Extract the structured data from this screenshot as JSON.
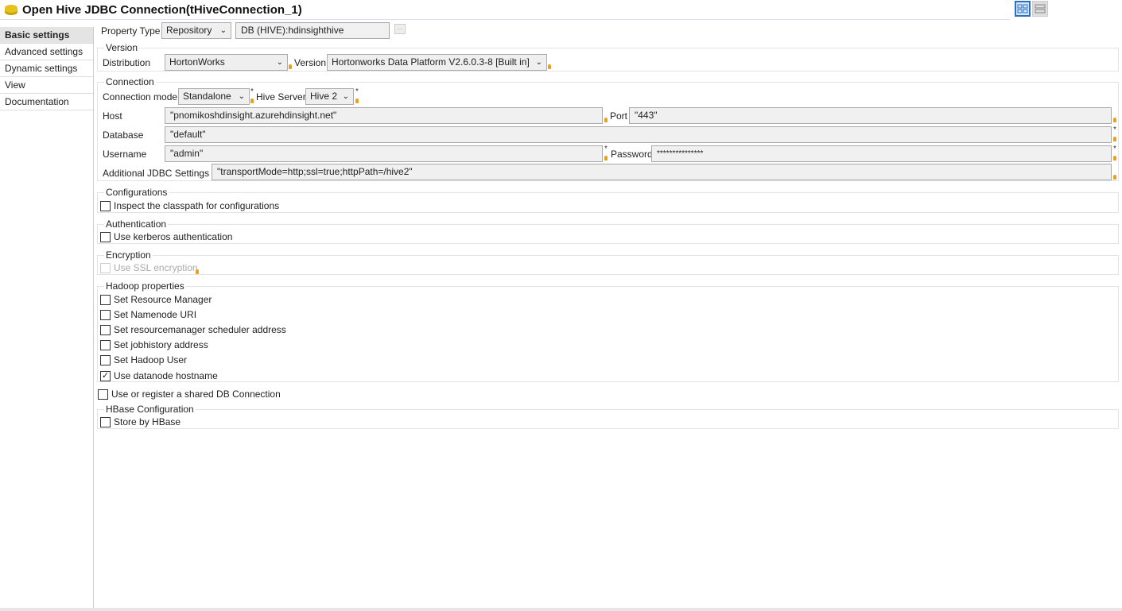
{
  "title": "Open Hive JDBC Connection(tHiveConnection_1)",
  "sidebar": {
    "items": [
      {
        "label": "Basic settings",
        "selected": true
      },
      {
        "label": "Advanced settings"
      },
      {
        "label": "Dynamic settings"
      },
      {
        "label": "View"
      },
      {
        "label": "Documentation"
      }
    ]
  },
  "property": {
    "label": "Property Type",
    "type": "Repository",
    "repo": "DB (HIVE):hdinsighthive",
    "browse": "..."
  },
  "version": {
    "legend": "Version",
    "distribution_label": "Distribution",
    "distribution": "HortonWorks",
    "version_label": "Version",
    "version": "Hortonworks Data Platform V2.6.0.3-8 [Built in]"
  },
  "connection": {
    "legend": "Connection",
    "mode_label": "Connection mode",
    "mode": "Standalone",
    "hive_server_label": "Hive Server",
    "hive_server": "Hive 2",
    "host_label": "Host",
    "host": "\"pnomikoshdinsight.azurehdinsight.net\"",
    "port_label": "Port",
    "port": "\"443\"",
    "database_label": "Database",
    "database": "\"default\"",
    "username_label": "Username",
    "username": "\"admin\"",
    "password_label": "Password",
    "password": "***************",
    "jdbc_label": "Additional JDBC Settings",
    "jdbc": "\"transportMode=http;ssl=true;httpPath=/hive2\""
  },
  "configurations": {
    "legend": "Configurations",
    "inspect": "Inspect the classpath for configurations"
  },
  "authentication": {
    "legend": "Authentication",
    "kerberos": "Use kerberos authentication"
  },
  "encryption": {
    "legend": "Encryption",
    "ssl": "Use SSL encryption"
  },
  "hadoop": {
    "legend": "Hadoop properties",
    "items": [
      {
        "label": "Set Resource Manager",
        "checked": false
      },
      {
        "label": "Set Namenode URI",
        "checked": false
      },
      {
        "label": "Set resourcemanager scheduler address",
        "checked": false
      },
      {
        "label": "Set jobhistory address",
        "checked": false
      },
      {
        "label": "Set Hadoop User",
        "checked": false
      },
      {
        "label": "Use datanode hostname",
        "checked": true
      }
    ]
  },
  "shared_db": "Use or register a shared DB Connection",
  "hbase": {
    "legend": "HBase Configuration",
    "store": "Store by HBase"
  },
  "check_mark": "✓",
  "chevron": "⌄"
}
